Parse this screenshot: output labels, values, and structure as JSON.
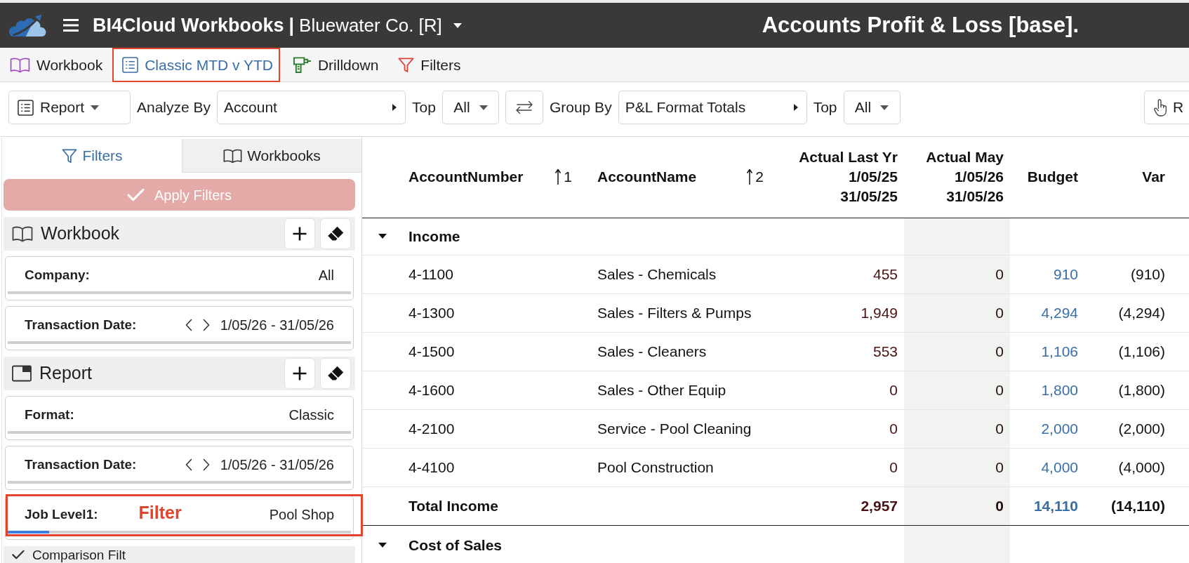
{
  "header": {
    "app_title": "BI4Cloud Workbooks",
    "separator": "|",
    "company": "Bluewater Co. [R]",
    "report_title": "Accounts Profit & Loss [base]."
  },
  "tabs": [
    {
      "kind": "workbook",
      "label": "Workbook",
      "selected": false,
      "highlighted": false
    },
    {
      "kind": "report",
      "label": "Classic MTD v YTD",
      "selected": true,
      "highlighted": true
    },
    {
      "kind": "drilldown",
      "label": "Drilldown",
      "selected": false,
      "highlighted": false
    },
    {
      "kind": "filters",
      "label": "Filters",
      "selected": false,
      "highlighted": false
    }
  ],
  "toolbar": [
    {
      "kind": "menu",
      "label": "Report"
    },
    {
      "kind": "label",
      "text": "Analyze By"
    },
    {
      "kind": "select",
      "value": "Account"
    },
    {
      "kind": "label",
      "text": "Top"
    },
    {
      "kind": "dropdown",
      "value": "All"
    },
    {
      "kind": "swap"
    },
    {
      "kind": "label",
      "text": "Group By"
    },
    {
      "kind": "select",
      "value": "P&L Format Totals"
    },
    {
      "kind": "label",
      "text": "Top"
    },
    {
      "kind": "dropdown",
      "value": "All"
    },
    {
      "kind": "action",
      "label": "R"
    }
  ],
  "sidebar": {
    "tabs": [
      {
        "kind": "filters",
        "label": "Filters",
        "selected": true
      },
      {
        "kind": "workbooks",
        "label": "Workbooks",
        "selected": false
      }
    ],
    "apply_button": {
      "label": "Apply Filters",
      "disabled": true
    },
    "sections": [
      {
        "kind": "workbook",
        "title": "Workbook",
        "tools": true,
        "filters": [
          {
            "kind": "plain",
            "label": "Company:",
            "value": "All",
            "highlighted": false
          },
          {
            "kind": "date",
            "label": "Transaction Date:",
            "value": "1/05/26 - 31/05/26",
            "highlighted": false
          }
        ]
      },
      {
        "kind": "report",
        "title": "Report",
        "tools": true,
        "filters": [
          {
            "kind": "plain",
            "label": "Format:",
            "value": "Classic",
            "highlighted": false
          },
          {
            "kind": "date",
            "label": "Transaction Date:",
            "value": "1/05/26 - 31/05/26",
            "highlighted": false
          },
          {
            "kind": "plain",
            "label": "Job Level1:",
            "value": "Pool Shop",
            "highlighted": true,
            "annotation": "Filter",
            "level": 0.12
          }
        ]
      },
      {
        "kind": "comparison",
        "title": "Comparison Filt",
        "tools": false
      }
    ]
  },
  "table": {
    "columns": [
      {
        "kind": "text",
        "label": "AccountNumber",
        "sort": "1"
      },
      {
        "kind": "text",
        "label": "AccountName",
        "sort": "2"
      },
      {
        "kind": "actual",
        "label": "Actual Last Yr\n1/05/25\n31/05/25"
      },
      {
        "kind": "current",
        "label": "Actual May\n1/05/26\n31/05/26"
      },
      {
        "kind": "budget",
        "label": "Budget"
      },
      {
        "kind": "variance",
        "label": "Var"
      }
    ],
    "rows": [
      {
        "kind": "group",
        "label": "Income",
        "expanded": true
      },
      {
        "kind": "account",
        "cells": [
          "4-1100",
          "Sales - Chemicals",
          "455",
          "0",
          "910",
          "(910)"
        ]
      },
      {
        "kind": "account",
        "cells": [
          "4-1300",
          "Sales - Filters & Pumps",
          "1,949",
          "0",
          "4,294",
          "(4,294)"
        ]
      },
      {
        "kind": "account",
        "cells": [
          "4-1500",
          "Sales - Cleaners",
          "553",
          "0",
          "1,106",
          "(1,106)"
        ]
      },
      {
        "kind": "account",
        "cells": [
          "4-1600",
          "Sales - Other Equip",
          "0",
          "0",
          "1,800",
          "(1,800)"
        ]
      },
      {
        "kind": "account",
        "cells": [
          "4-2100",
          "Service - Pool Cleaning",
          "0",
          "0",
          "2,000",
          "(2,000)"
        ]
      },
      {
        "kind": "account",
        "cells": [
          "4-4100",
          "Pool Construction",
          "0",
          "0",
          "4,000",
          "(4,000)"
        ]
      },
      {
        "kind": "total",
        "label": "Total Income",
        "cells": [
          "2,957",
          "0",
          "14,110",
          "(14,110)"
        ]
      },
      {
        "kind": "group",
        "label": "Cost of Sales",
        "expanded": true
      }
    ]
  }
}
